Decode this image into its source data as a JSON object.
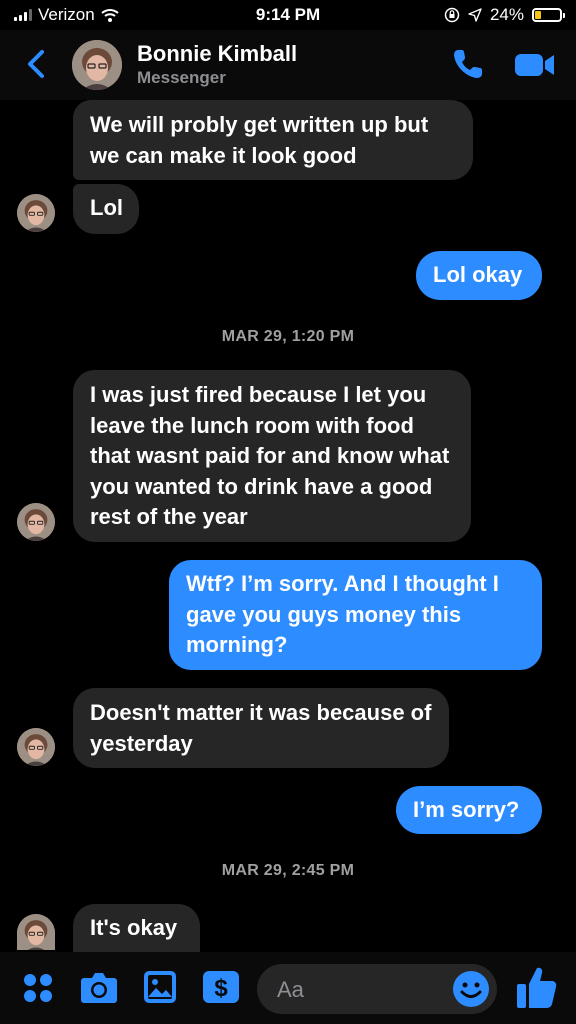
{
  "status_bar": {
    "carrier": "Verizon",
    "time": "9:14 PM",
    "battery": "24%"
  },
  "header": {
    "name": "Bonnie Kimball",
    "subtitle": "Messenger"
  },
  "messages": [
    {
      "text": "We will probly get written up but we can make it look good",
      "direction": "incoming"
    },
    {
      "text": "Lol",
      "direction": "incoming"
    },
    {
      "text": "Lol okay",
      "direction": "outgoing"
    },
    {
      "text": "MAR 29, 1:20 PM",
      "direction": "timestamp"
    },
    {
      "text": "I was just fired because I let you leave the lunch room with food that wasnt paid for and know what you wanted to drink have a good rest of the year",
      "direction": "incoming"
    },
    {
      "text": "Wtf? I’m sorry. And I thought I gave you guys money this morning?",
      "direction": "outgoing"
    },
    {
      "text": "Doesn't matter it was because of yesterday",
      "direction": "incoming"
    },
    {
      "text": "I’m sorry?",
      "direction": "outgoing"
    },
    {
      "text": "MAR 29, 2:45 PM",
      "direction": "timestamp"
    },
    {
      "text": "It's okay",
      "direction": "incoming"
    }
  ],
  "composer": {
    "placeholder": "Aa",
    "icons": [
      "grid-icon",
      "camera-icon",
      "gallery-icon",
      "payment-icon",
      "emoji-icon",
      "thumbs-up-icon"
    ]
  },
  "colors": {
    "outgoing_bubble": "#2d8cff",
    "incoming_bubble": "#262626",
    "accent": "#2d8cff",
    "background": "#000000"
  }
}
